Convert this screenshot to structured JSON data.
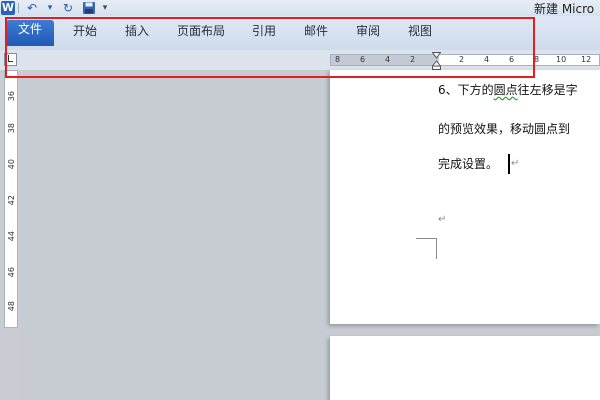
{
  "quick_access": {
    "app_icon": "W",
    "undo_icon": "undo-icon",
    "dropdown_icon": "▾",
    "redo_icon": "redo-icon",
    "save_icon": "save-icon",
    "customize_icon": "customize-icon"
  },
  "window": {
    "title": "新建 Micro"
  },
  "ribbon": {
    "file_tab": "文件",
    "tabs": [
      "开始",
      "插入",
      "页面布局",
      "引用",
      "邮件",
      "审阅",
      "视图"
    ]
  },
  "ruler": {
    "horizontal_ticks": [
      "8",
      "6",
      "4",
      "2",
      "2",
      "4",
      "6",
      "8",
      "10",
      "12"
    ],
    "vertical_ticks": [
      "36",
      "38",
      "40",
      "42",
      "44",
      "46",
      "48"
    ]
  },
  "document": {
    "lines": [
      "6、下方的圆点往左移是字",
      "的预览效果，移动圆点到",
      "完成设置。"
    ],
    "wavy_word": "圆点",
    "paragraph_mark": "↵"
  },
  "colors": {
    "file_tab": "#2a63b8",
    "annotation": "#e01f1f",
    "ribbon": "#dfe8f5"
  }
}
